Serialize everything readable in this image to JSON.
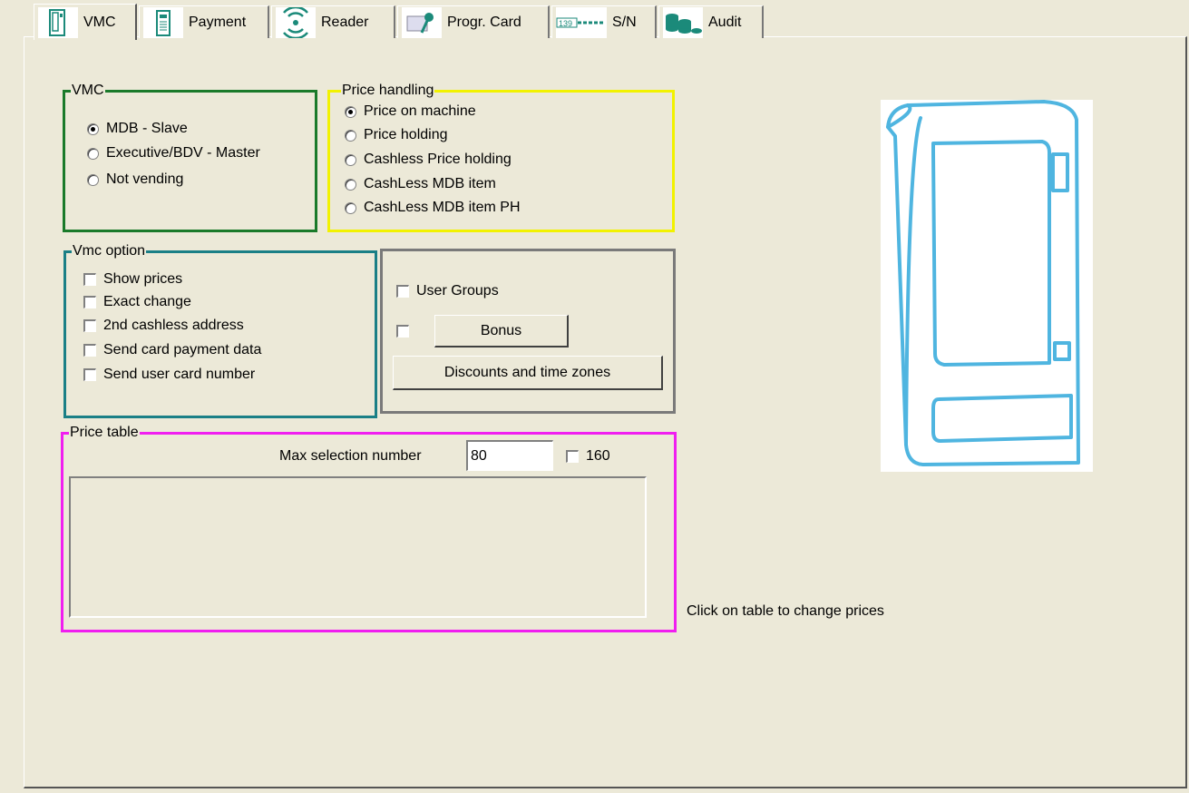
{
  "tabs": [
    {
      "label": "VMC",
      "icon": "vending-machine-icon"
    },
    {
      "label": "Payment",
      "icon": "coin-changer-icon"
    },
    {
      "label": "Reader",
      "icon": "contactless-icon"
    },
    {
      "label": "Progr. Card",
      "icon": "card-key-icon"
    },
    {
      "label": "S/N",
      "icon": "serial-tape-icon",
      "icon_text": "139"
    },
    {
      "label": "Audit",
      "icon": "coins-stack-icon"
    }
  ],
  "vmc_group": {
    "title": "VMC",
    "options": [
      "MDB - Slave",
      "Executive/BDV - Master",
      "Not vending"
    ],
    "selected": "MDB - Slave"
  },
  "price_handling": {
    "title": "Price handling",
    "options": [
      "Price on machine",
      "Price holding",
      "Cashless Price holding",
      "CashLess MDB item",
      "CashLess MDB item PH"
    ],
    "selected": "Price on machine"
  },
  "vmc_option": {
    "title": "Vmc option",
    "options": [
      "Show prices",
      "Exact change",
      "2nd cashless address",
      "Send card payment data",
      "Send user card number"
    ]
  },
  "extras": {
    "user_groups_label": "User Groups",
    "bonus_label": "Bonus",
    "discounts_label": "Discounts and time zones"
  },
  "price_table": {
    "title": "Price table",
    "max_selection_label": "Max selection number",
    "max_selection_value": "80",
    "alt_checkbox_label": "160",
    "hint": "Click on table to change prices"
  },
  "colors": {
    "vmc_border": "#1a7a2a",
    "price_handling_border": "#f2f200",
    "vmc_option_border": "#1a7f86",
    "extras_border": "#7a7a7a",
    "price_table_border": "#f01ef0",
    "machine_line": "#4fb5e0",
    "icon_teal": "#1b8a7a"
  }
}
